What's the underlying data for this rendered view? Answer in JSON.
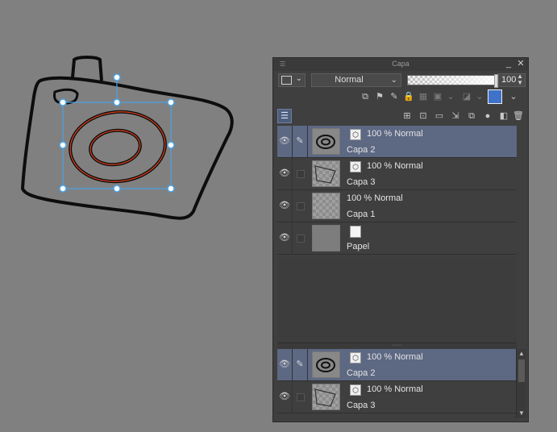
{
  "panel": {
    "title": "Capa",
    "blend_mode": "Normal",
    "opacity_value": "100",
    "opacity_fraction": 1.0,
    "icons": {
      "menu": "menu-icon",
      "minimize": "minimize-icon",
      "close": "close-icon"
    }
  },
  "layers": [
    {
      "mode": "100 % Normal",
      "name": "Capa 2",
      "selected": true,
      "kind": "vector"
    },
    {
      "mode": "100 % Normal",
      "name": "Capa 3",
      "selected": false,
      "kind": "vector"
    },
    {
      "mode": "100 % Normal",
      "name": "Capa 1",
      "selected": false,
      "kind": "raster"
    },
    {
      "mode": "",
      "name": "Papel",
      "selected": false,
      "kind": "paper"
    }
  ],
  "preview_layers": [
    {
      "mode": "100 % Normal",
      "name": "Capa 2",
      "selected": true
    },
    {
      "mode": "100 % Normal",
      "name": "Capa 3",
      "selected": false
    }
  ],
  "colors": {
    "canvas_bg": "#808080",
    "panel_bg": "#3f3f3f",
    "selection": "#5d6883",
    "transform_box": "#4aa3e6",
    "vector_highlight": "#e0401c"
  }
}
